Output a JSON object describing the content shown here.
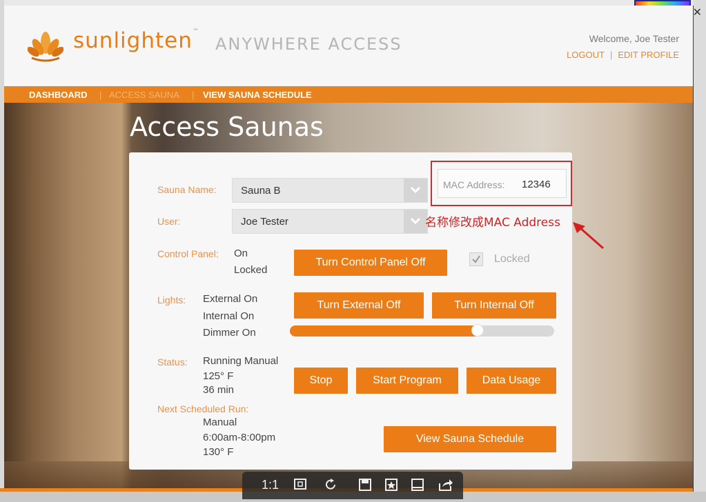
{
  "header": {
    "brand": "sunlighten",
    "brand_tm": "™",
    "tagline": "ANYWHERE ACCESS",
    "welcome": "Welcome, Joe Tester",
    "logout": "LOGOUT",
    "edit_profile": "EDIT PROFILE"
  },
  "nav": {
    "items": [
      {
        "label": "DASHBOARD"
      },
      {
        "label": "ACCESS SAUNA"
      },
      {
        "label": "VIEW SAUNA SCHEDULE"
      }
    ]
  },
  "page": {
    "title": "Access Saunas"
  },
  "form": {
    "sauna_name_label": "Sauna Name:",
    "sauna_name_value": "Sauna B",
    "user_label": "User:",
    "user_value": "Joe Tester",
    "mac_label": "MAC Address:",
    "mac_value": "12346",
    "annotation": "名称修改成MAC Address"
  },
  "control_panel": {
    "label": "Control Panel:",
    "state": "On",
    "lock_state": "Locked",
    "button": "Turn Control Panel Off",
    "locked_checkbox_label": "Locked",
    "locked_checked": true
  },
  "lights": {
    "label": "Lights:",
    "external": "External On",
    "internal": "Internal On",
    "dimmer": "Dimmer On",
    "btn_external": "Turn External Off",
    "btn_internal": "Turn Internal Off",
    "dimmer_level": 0.71
  },
  "status": {
    "label": "Status:",
    "mode": "Running Manual",
    "temp": "125° F",
    "time": "36 min",
    "btn_stop": "Stop",
    "btn_start": "Start Program",
    "btn_data": "Data Usage"
  },
  "next_run": {
    "label": "Next Scheduled Run:",
    "mode": "Manual",
    "time": "6:00am-8:00pm",
    "temp": "130° F",
    "btn_schedule": "View Sauna Schedule"
  },
  "viewer_toolbar": {
    "ratio": "1:1"
  },
  "colors": {
    "accent": "#ec7d16",
    "annotation": "#d42020"
  }
}
